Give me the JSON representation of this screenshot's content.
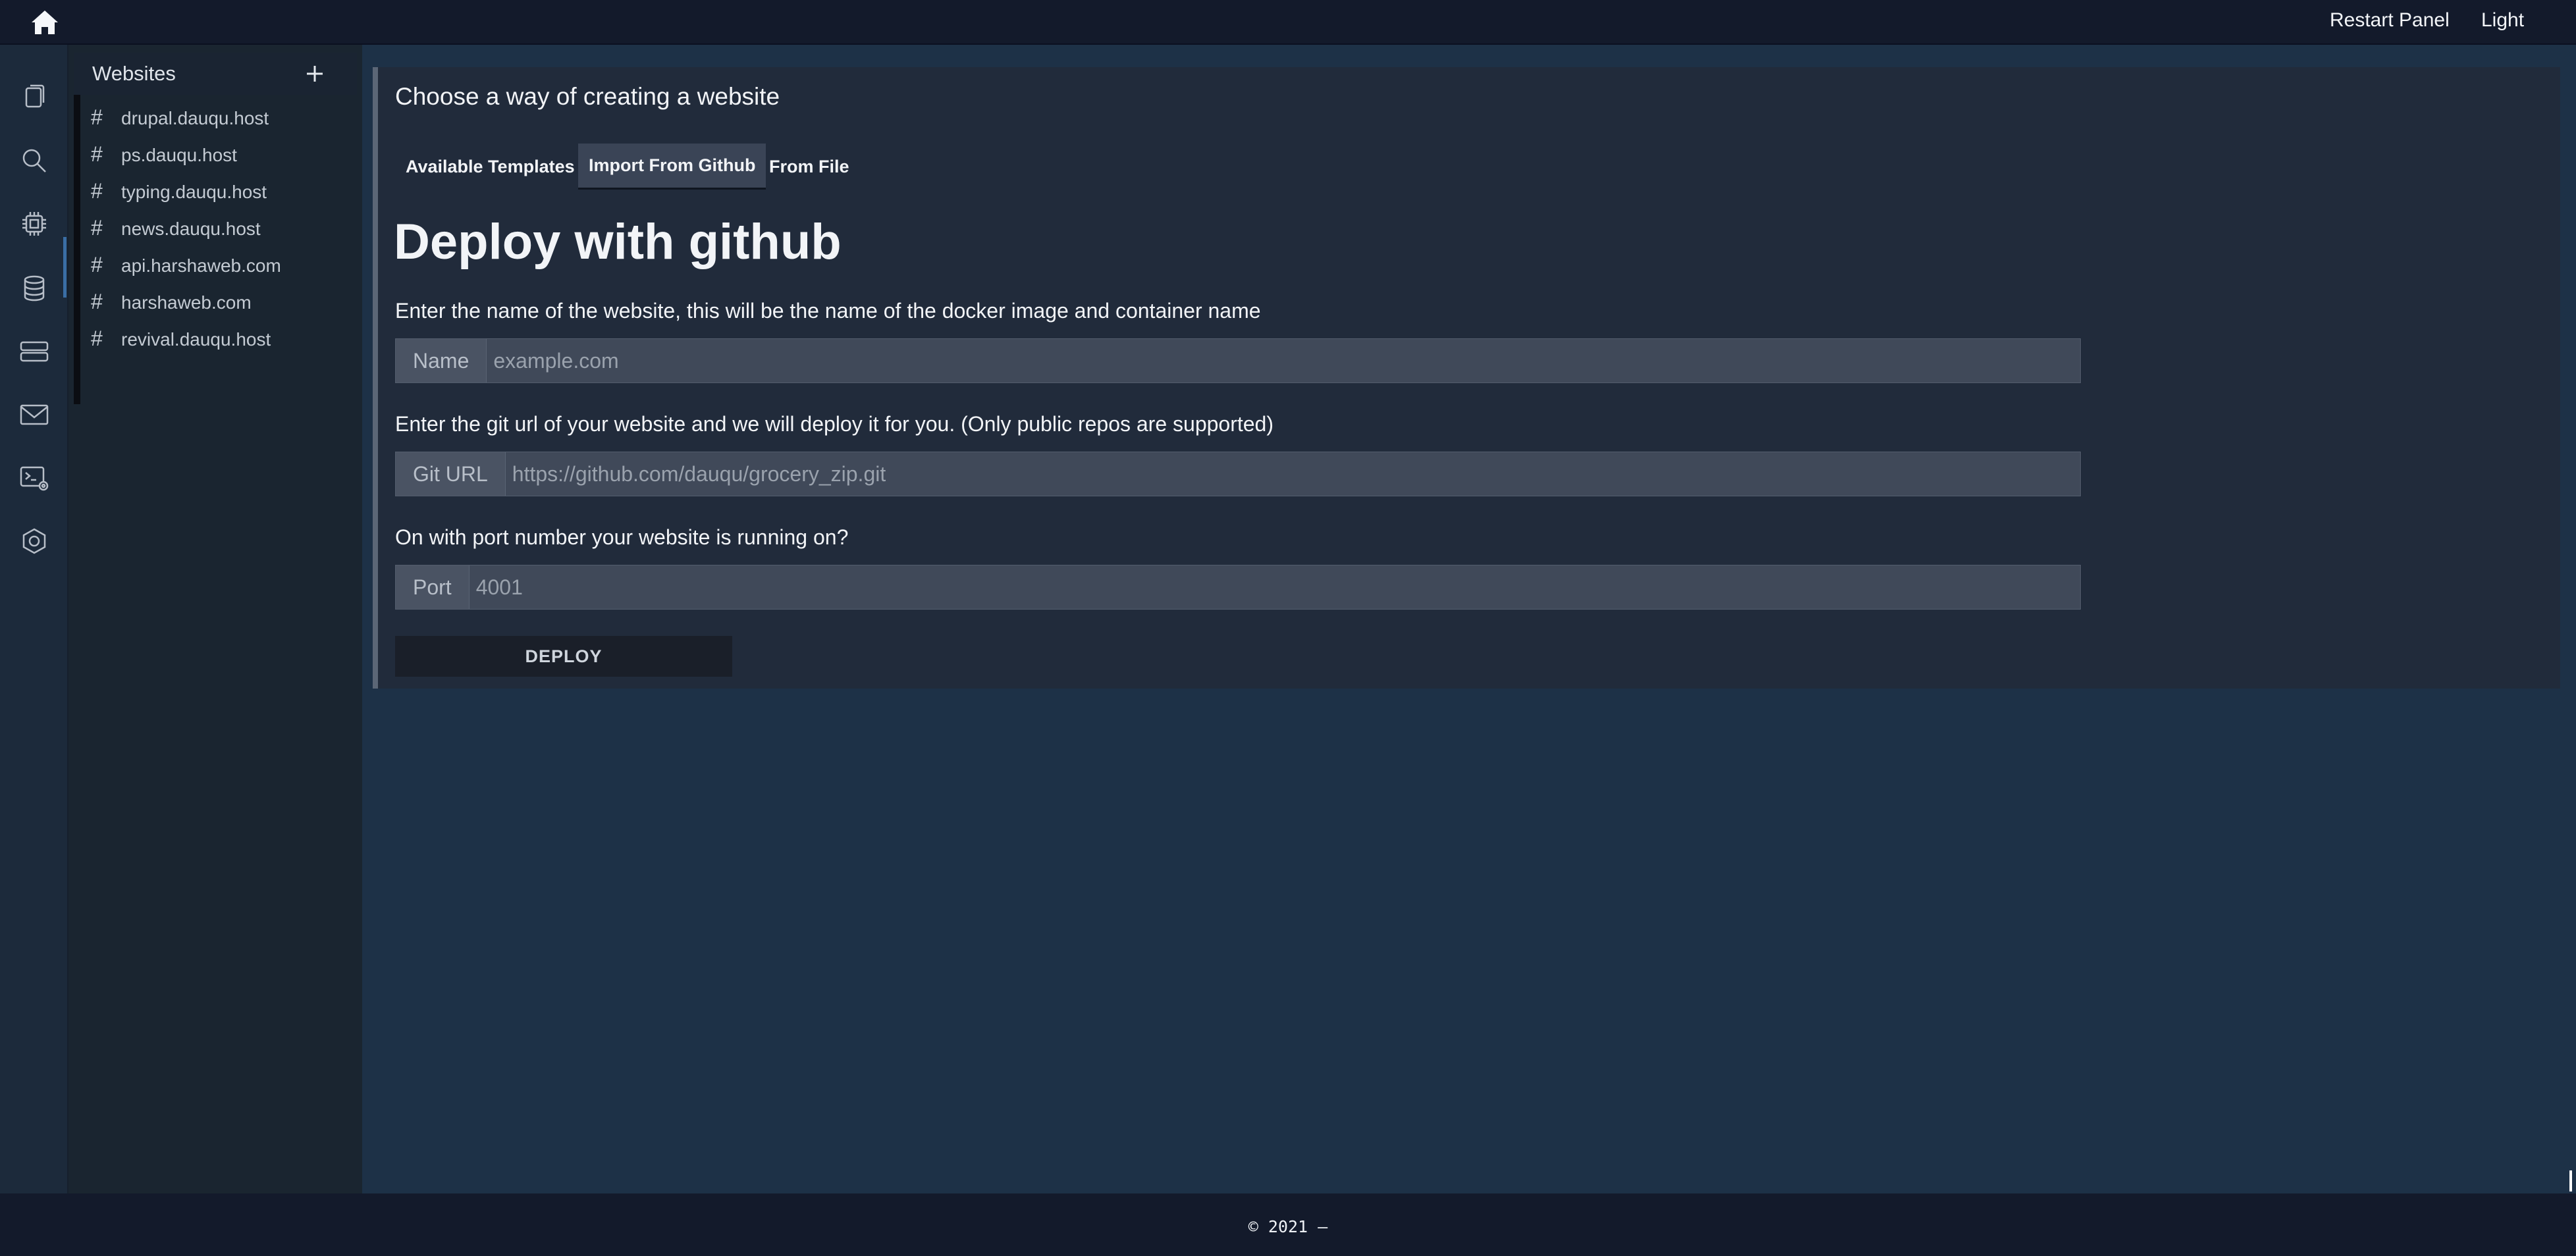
{
  "topbar": {
    "home_icon": "home-icon",
    "restart_label": "Restart Panel",
    "theme_label": "Light"
  },
  "nav_icons": [
    "files-icon",
    "search-icon",
    "cpu-icon",
    "database-icon",
    "server-icon",
    "mail-icon",
    "terminal-icon",
    "settings-icon"
  ],
  "nav_active": "cpu-icon",
  "sidebar": {
    "title": "Websites",
    "add_icon": "plus-icon",
    "items": [
      {
        "hash": "#",
        "label": "drupal.dauqu.host"
      },
      {
        "hash": "#",
        "label": "ps.dauqu.host"
      },
      {
        "hash": "#",
        "label": "typing.dauqu.host"
      },
      {
        "hash": "#",
        "label": "news.dauqu.host"
      },
      {
        "hash": "#",
        "label": "api.harshaweb.com"
      },
      {
        "hash": "#",
        "label": "harshaweb.com"
      },
      {
        "hash": "#",
        "label": "revival.dauqu.host"
      }
    ]
  },
  "main": {
    "title": "Choose a way of creating a website",
    "tabs": [
      {
        "label": "Available Templates",
        "active": false
      },
      {
        "label": "Import From Github",
        "active": true
      },
      {
        "label": "From File",
        "active": false
      }
    ],
    "heading": "Deploy with github",
    "name_prompt": "Enter the name of the website, this will be the name of the docker image and container name",
    "name_addon": "Name",
    "name_placeholder": "example.com",
    "name_value": "",
    "git_prompt": "Enter the git url of your website and we will deploy it for you. (Only public repos are supported)",
    "git_addon": "Git URL",
    "git_placeholder": "https://github.com/dauqu/grocery_zip.git",
    "git_value": "",
    "port_prompt": "On with port number your website is running on?",
    "port_addon": "Port",
    "port_placeholder": "4001",
    "port_value": "",
    "deploy_label": "DEPLOY"
  },
  "footer": {
    "text": "© 2021 –"
  },
  "colors": {
    "page_bg": "#1d3147",
    "topbar_bg": "#131a2b",
    "card_bg": "#212b3b",
    "sidebar_bg": "#1a2530",
    "accent": "#3a6ea5"
  }
}
